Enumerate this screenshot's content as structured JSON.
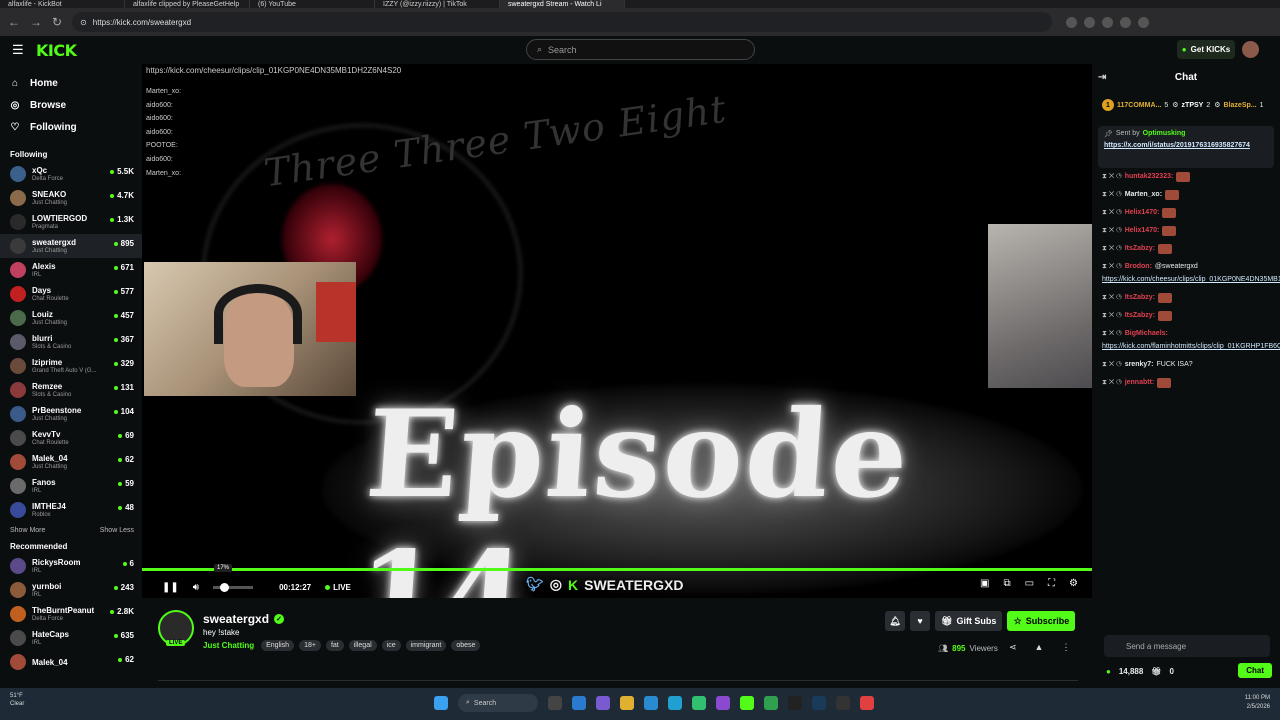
{
  "browser": {
    "tabs": [
      {
        "label": "alfaxlife - KickBot",
        "active": false
      },
      {
        "label": "alfaxlife clipped by PleaseGetHelp",
        "active": false
      },
      {
        "label": "(6) YouTube",
        "active": false
      },
      {
        "label": "IZZY (@izzy.riizzy) | TikTok",
        "active": false
      },
      {
        "label": "sweatergxd Stream - Watch Li",
        "active": true
      }
    ],
    "url": "https://kick.com/sweatergxd"
  },
  "header": {
    "logo": "KICK",
    "search_placeholder": "Search",
    "get_kicks_label": "Get KICKs"
  },
  "sidebar": {
    "nav": [
      {
        "label": "Home",
        "icon": "home-icon"
      },
      {
        "label": "Browse",
        "icon": "compass-icon"
      },
      {
        "label": "Following",
        "icon": "heart-icon"
      }
    ],
    "following_heading": "Following",
    "following": [
      {
        "name": "xQc",
        "category": "Delta Force",
        "viewers": "5.5K",
        "color": "#3a5f8a"
      },
      {
        "name": "SNEAKO",
        "category": "Just Chatting",
        "viewers": "4.7K",
        "color": "#8a6a4a"
      },
      {
        "name": "LOWTIERGOD",
        "category": "Pragmata",
        "viewers": "1.3K",
        "color": "#2a2a2a"
      },
      {
        "name": "sweatergxd",
        "category": "Just Chatting",
        "viewers": "895",
        "color": "#3a3a3a",
        "selected": true
      },
      {
        "name": "Alexis",
        "category": "IRL",
        "viewers": "671",
        "color": "#c04060"
      },
      {
        "name": "Days",
        "category": "Chat Roulette",
        "viewers": "577",
        "color": "#c02020"
      },
      {
        "name": "Louiz",
        "category": "Just Chatting",
        "viewers": "457",
        "color": "#4a6a4a"
      },
      {
        "name": "blurri",
        "category": "Slots & Casino",
        "viewers": "367",
        "color": "#5a5a6a"
      },
      {
        "name": "Iziprime",
        "category": "Grand Theft Auto V (G...",
        "viewers": "329",
        "color": "#6a4a3a"
      },
      {
        "name": "Remzee",
        "category": "Slots & Casino",
        "viewers": "131",
        "color": "#8a3a3a"
      },
      {
        "name": "PrBeenstone",
        "category": "Just Chatting",
        "viewers": "104",
        "color": "#3a5a8a"
      },
      {
        "name": "KevvTv",
        "category": "Chat Roulette",
        "viewers": "69",
        "color": "#4a4a4a"
      },
      {
        "name": "Malek_04",
        "category": "Just Chatting",
        "viewers": "62",
        "color": "#a04a3a"
      },
      {
        "name": "Fanos",
        "category": "IRL",
        "viewers": "59",
        "color": "#6a6a6a"
      },
      {
        "name": "IMTHEJ4",
        "category": "Roblox",
        "viewers": "48",
        "color": "#3a4a9a"
      }
    ],
    "show_more": "Show More",
    "show_less": "Show Less",
    "recommended_heading": "Recommended",
    "recommended": [
      {
        "name": "RickysRoom",
        "category": "IRL",
        "viewers": "6",
        "color": "#5a4a8a"
      },
      {
        "name": "yurnboi",
        "category": "IRL",
        "viewers": "243",
        "color": "#8a5a3a"
      },
      {
        "name": "TheBurntPeanut",
        "category": "Delta Force",
        "viewers": "2.8K",
        "color": "#c06020"
      },
      {
        "name": "HateCaps",
        "category": "IRL",
        "viewers": "635",
        "color": "#4a4a4a"
      },
      {
        "name": "Malek_04",
        "category": "",
        "viewers": "62",
        "color": "#a04a3a"
      }
    ]
  },
  "player": {
    "overlay_url": "https://kick.com/cheesur/clips/clip_01KGP0NE4DN35MB1DH2Z6N4S20",
    "overlay_chat": [
      "Marten_xo:",
      "aido600:",
      "aido600:",
      "aido600:",
      "POOTOE:",
      "aido600:",
      "Marten_xo:"
    ],
    "fancy_text": "Three Three Two Eight",
    "episode_text": "Episode 14",
    "volume_tip": "17%",
    "progress_fraction": 1.0,
    "volume_fraction": 0.17,
    "time": "00:12:27",
    "live_label": "LIVE",
    "brand_text": "SWEATERGXD"
  },
  "channel": {
    "name": "sweatergxd",
    "live_tag": "LIVE",
    "title": "hey !stake",
    "category": "Just Chatting",
    "tags": [
      "English",
      "18+",
      "fat",
      "illegal",
      "ice",
      "immigrant",
      "obese"
    ],
    "gift_subs_label": "Gift Subs",
    "subscribe_label": "Subscribe",
    "viewers": "895",
    "viewers_label": "Viewers"
  },
  "chat": {
    "title": "Chat",
    "leaderboard": [
      {
        "rank": "1",
        "name": "117COMMA...",
        "count": "5"
      },
      {
        "rank": "",
        "name": "zTPSY",
        "count": "2"
      },
      {
        "rank": "",
        "name": "BlazeSp...",
        "count": "1"
      }
    ],
    "pinned_by_label": "Sent by",
    "pinned_by": "Optimusking",
    "pinned_link": "https://x.com/i/status/2019176316935827674",
    "messages": [
      {
        "user": "huntak232323:",
        "color": "#e04050",
        "text": ""
      },
      {
        "user": "Marten_xo:",
        "color": "#e8eaea",
        "text": ""
      },
      {
        "user": "Helix1470:",
        "color": "#e04050",
        "text": ""
      },
      {
        "user": "Helix1470:",
        "color": "#e04050",
        "text": ""
      },
      {
        "user": "ItsZabzy:",
        "color": "#e04050",
        "text": ""
      },
      {
        "user": "Brodon:",
        "color": "#e04050",
        "text": "@sweatergxd",
        "link": "https://kick.com/cheesur/clips/clip_01KGP0NE4DN35MB1DH2Z6N4S20"
      },
      {
        "user": "ItsZabzy:",
        "color": "#e04050",
        "text": ""
      },
      {
        "user": "ItsZabzy:",
        "color": "#e04050",
        "text": ""
      },
      {
        "user": "BigMichaels:",
        "color": "#e04050",
        "text": "",
        "link": "https://kick.com/flaminhotmitts/clips/clip_01KGRHP1FB6Q2G3C1MBAJP7W8"
      },
      {
        "user": "srenky7:",
        "color": "#e8eaea",
        "text": "FUCK ISA?"
      },
      {
        "user": "jennabtt:",
        "color": "#e04050",
        "text": ""
      }
    ],
    "input_placeholder": "Send a message",
    "kicks_count": "14,888",
    "gift_count": "0",
    "chat_button": "Chat"
  },
  "taskbar": {
    "weather_temp": "51°F",
    "weather_desc": "Clear",
    "search_label": "Search",
    "time": "11:00 PM",
    "date": "2/5/2026"
  },
  "colors": {
    "accent": "#53fc18",
    "bg": "#0b0e0f"
  }
}
